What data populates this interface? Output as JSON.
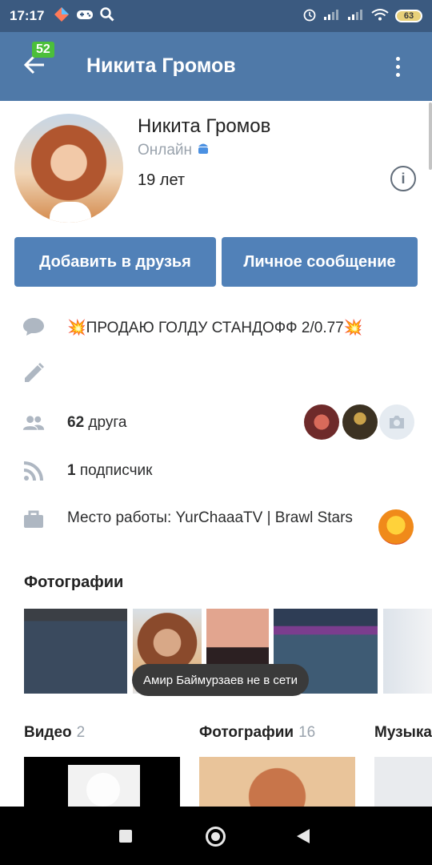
{
  "status_bar": {
    "time": "17:17",
    "battery": "63"
  },
  "header": {
    "badge_count": "52",
    "title": "Никита Громов"
  },
  "profile": {
    "name": "Никита Громов",
    "status": "Онлайн",
    "age": "19 лет"
  },
  "actions": {
    "add_friend": "Добавить в друзья",
    "message": "Личное сообщение"
  },
  "info": {
    "status_text": "💥ПРОДАЮ ГОЛДУ СТАНДОФФ 2/0.77💥",
    "friends_count": "62",
    "friends_label": "друга",
    "subscribers_count": "1",
    "subscribers_label": "подписчик",
    "work": "Место работы: YurChaaaTV | Brawl Stars"
  },
  "photos_section": {
    "title": "Фотографии"
  },
  "toast": "Амир Баймурзаев не в сети",
  "media": [
    {
      "label": "Видео",
      "count": "2"
    },
    {
      "label": "Фотографии",
      "count": "16"
    },
    {
      "label": "Музыка",
      "count": ""
    }
  ],
  "colors": {
    "status_bar": "#3b5a80",
    "header": "#4f79a8",
    "button": "#5181b8",
    "badge": "#4bbf3a"
  }
}
